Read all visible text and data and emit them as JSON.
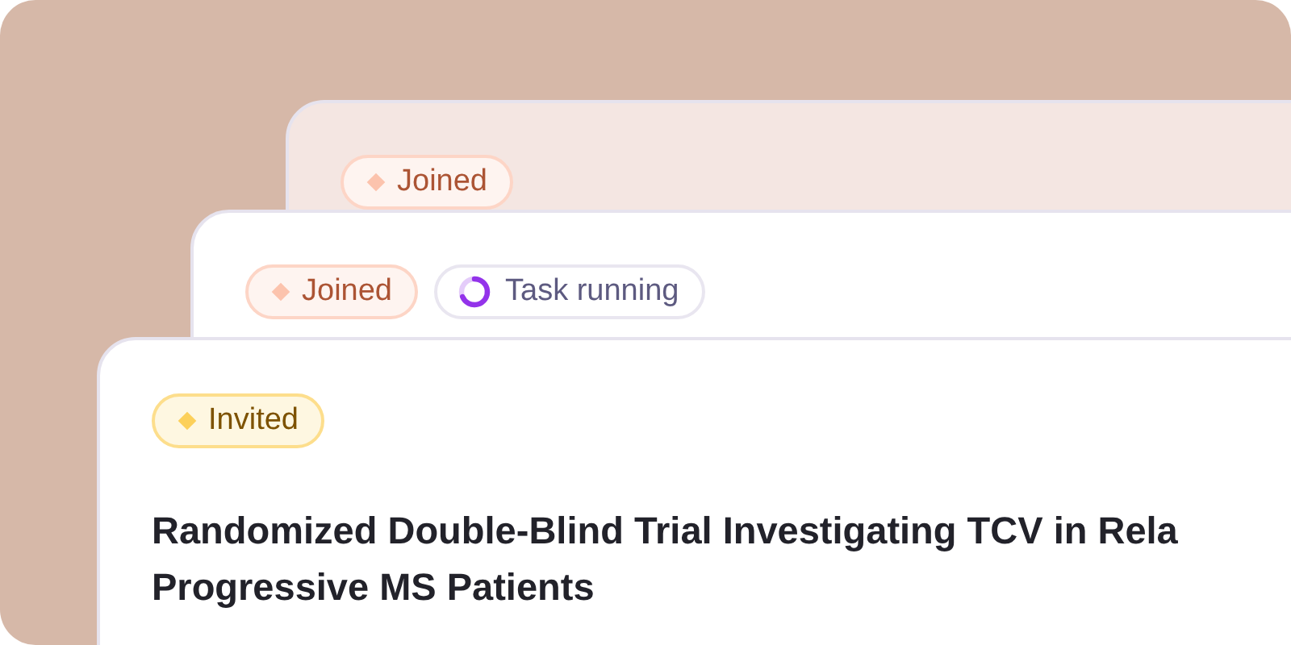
{
  "cards": [
    {
      "badges": [
        {
          "kind": "status",
          "label": "Joined",
          "color": "#fcc3ad"
        }
      ]
    },
    {
      "badges": [
        {
          "kind": "status",
          "label": "Joined",
          "color": "#fcc3ad"
        },
        {
          "kind": "task",
          "label": "Task running",
          "color": "#9333ea"
        }
      ]
    },
    {
      "badges": [
        {
          "kind": "status",
          "label": "Invited",
          "color": "#fcd05a"
        }
      ],
      "title_lines": [
        "Randomized Double-Blind Trial Investigating TCV in Rela",
        "Progressive MS Patients"
      ]
    }
  ]
}
